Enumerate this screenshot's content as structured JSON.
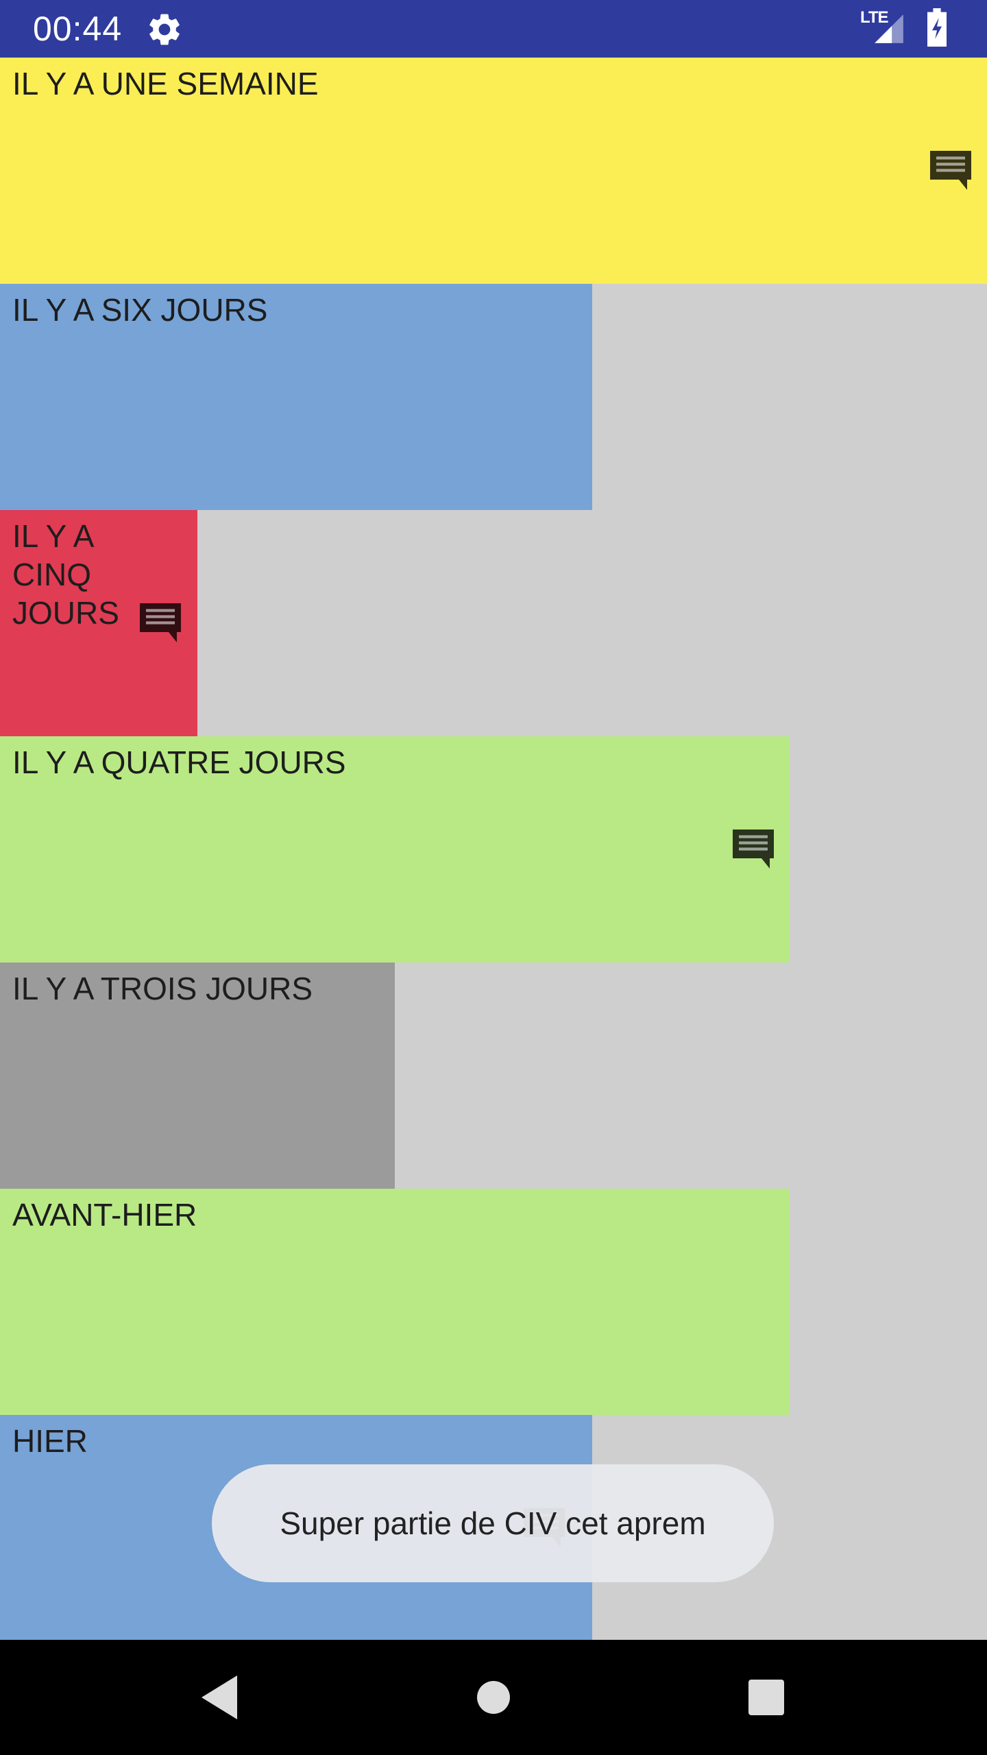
{
  "status_bar": {
    "time": "00:44",
    "network": "LTE",
    "icons": [
      "gear-icon",
      "signal-icon",
      "battery-charging-icon"
    ]
  },
  "days": [
    {
      "label": "IL Y A UNE SEMAINE",
      "color": "#fbee55",
      "fraction": 1.0,
      "has_comment": true
    },
    {
      "label": "IL Y A SIX JOURS",
      "color": "#77a3d6",
      "fraction": 0.6,
      "has_comment": false
    },
    {
      "label": "IL Y A CINQ JOURS",
      "color": "#e03c53",
      "fraction": 0.2,
      "has_comment": true
    },
    {
      "label": "IL Y A QUATRE JOURS",
      "color": "#b9e985",
      "fraction": 0.8,
      "has_comment": true
    },
    {
      "label": "IL Y A TROIS JOURS",
      "color": "#9b9b9b",
      "fraction": 0.4,
      "has_comment": false
    },
    {
      "label": "AVANT-HIER",
      "color": "#b9e985",
      "fraction": 0.8,
      "has_comment": false
    },
    {
      "label": "HIER",
      "color": "#77a3d6",
      "fraction": 0.6,
      "has_comment": true
    }
  ],
  "toast": {
    "message": "Super partie de CIV cet aprem"
  },
  "nav": {
    "icons": [
      "back-icon",
      "home-icon",
      "recents-icon"
    ]
  }
}
